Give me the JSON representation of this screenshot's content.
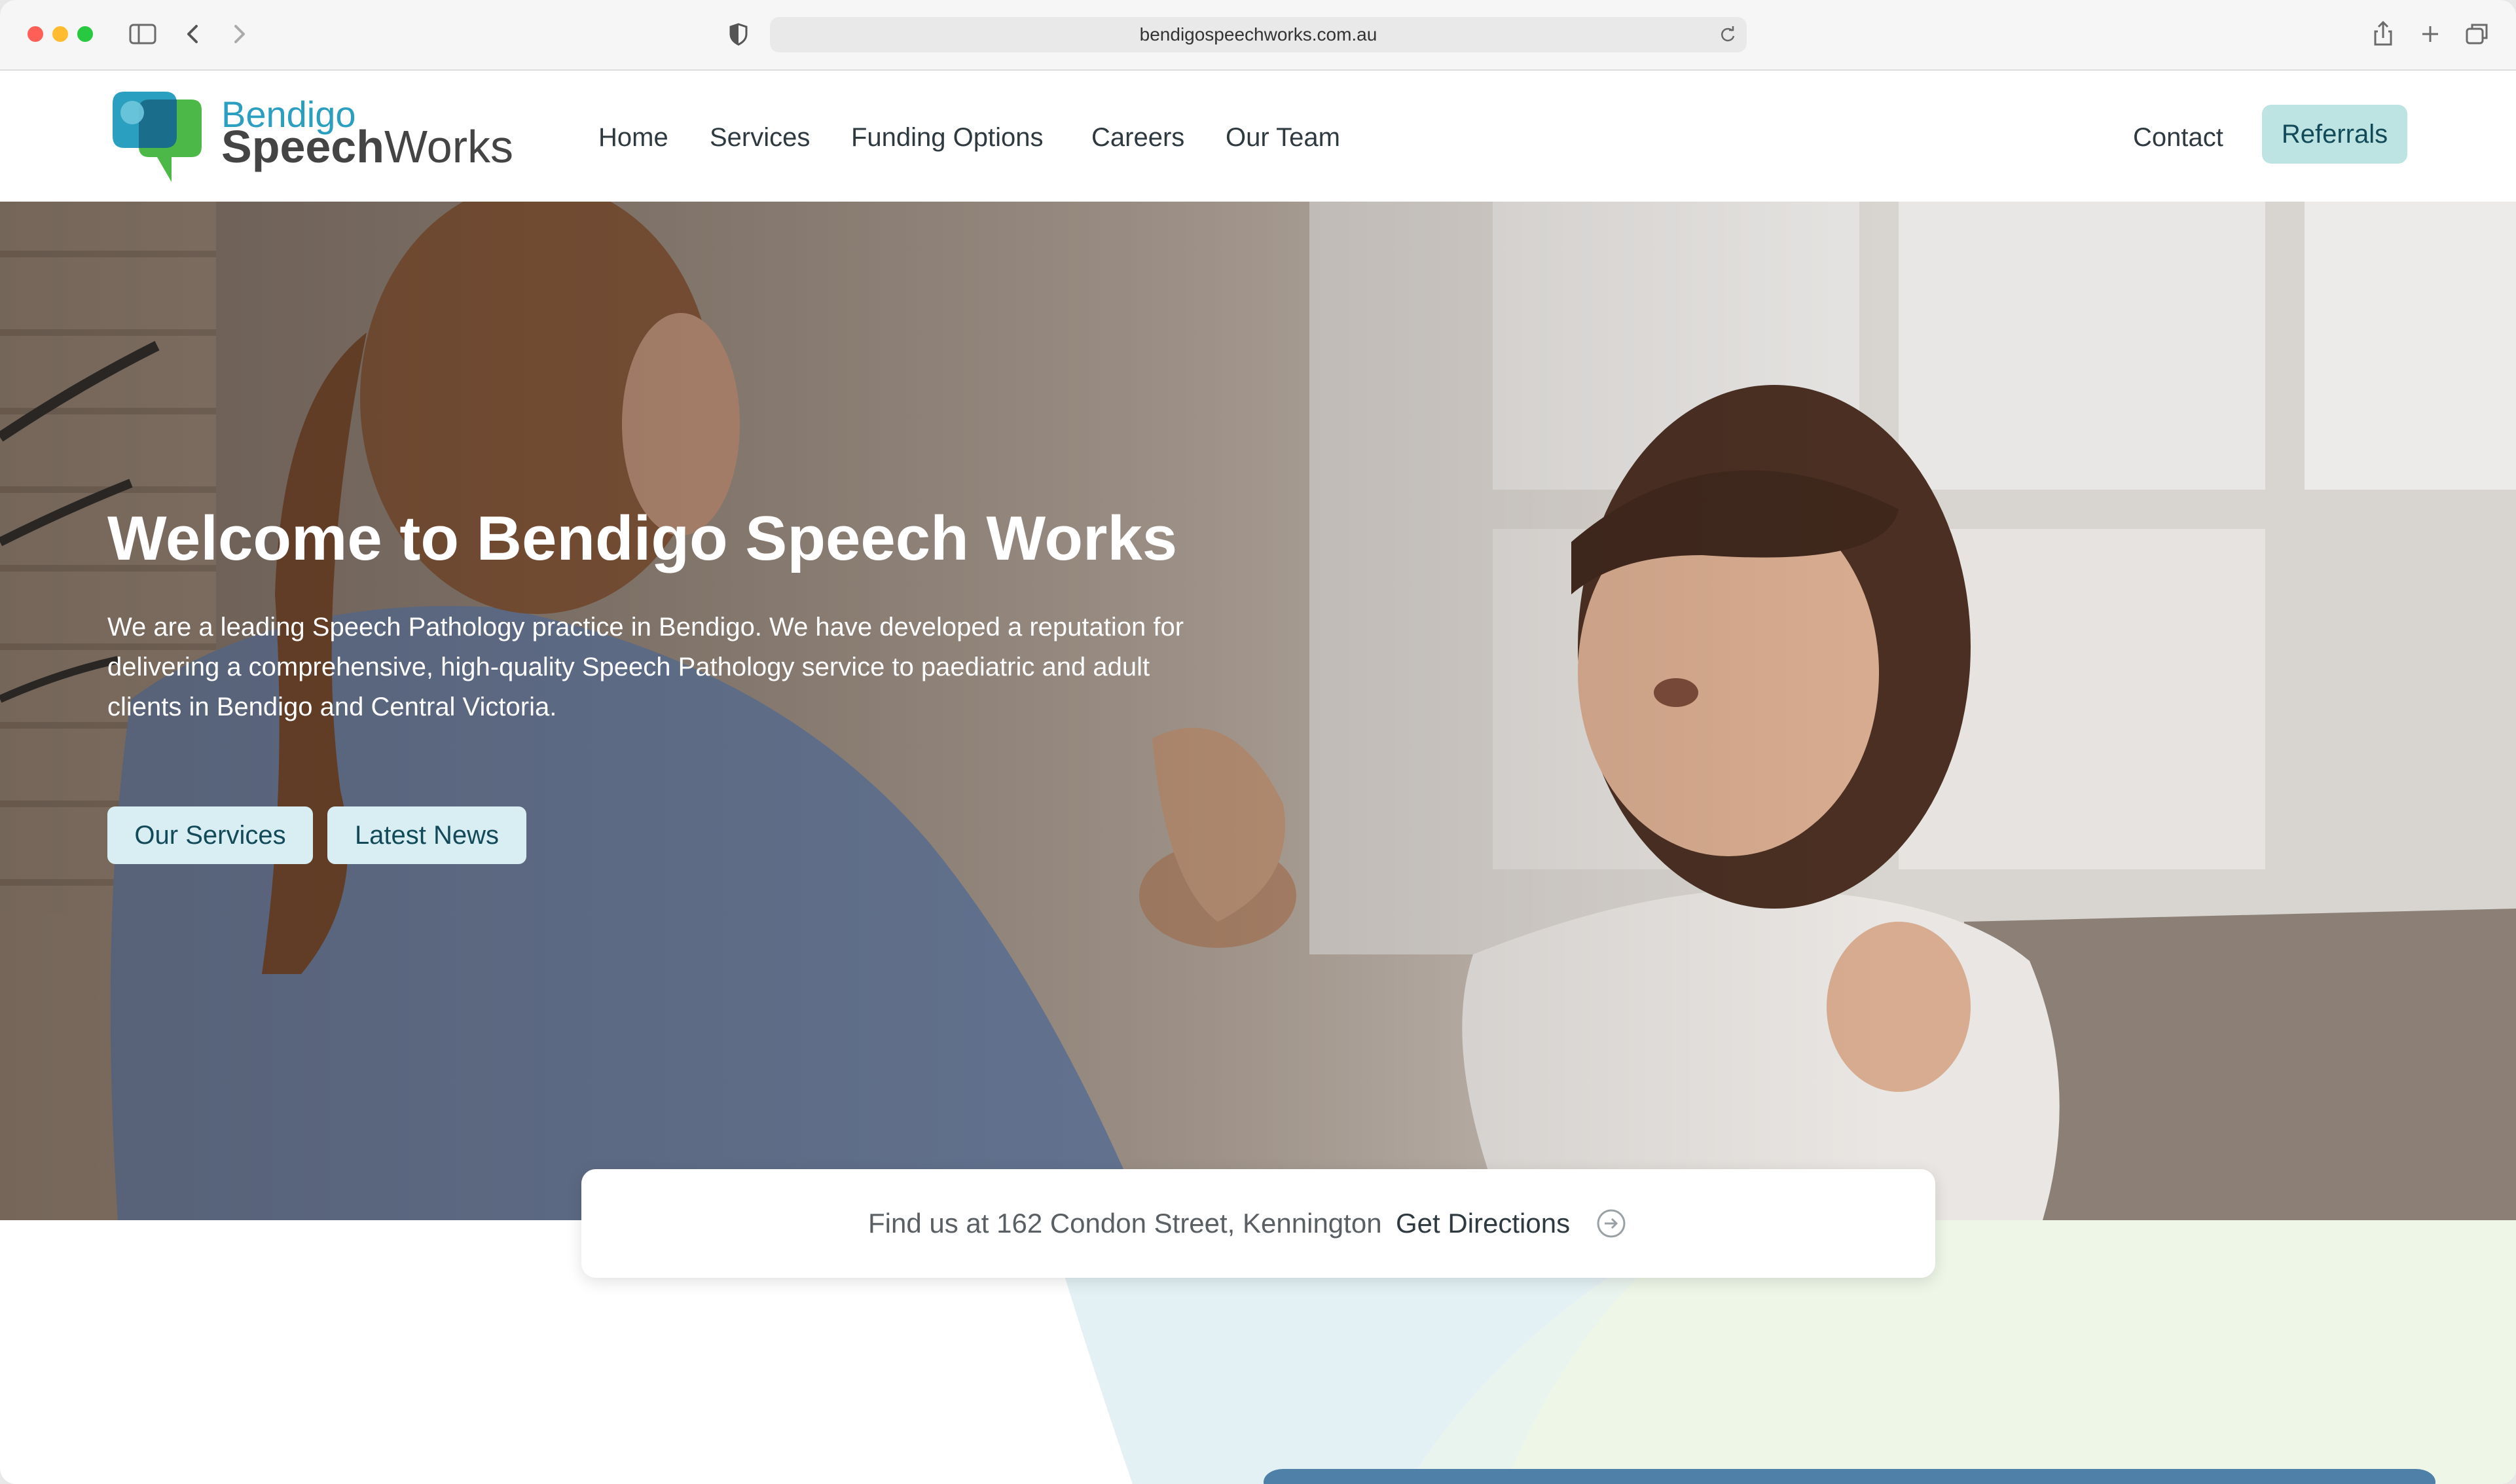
{
  "browser": {
    "url": "bendigospeechworks.com.au",
    "icons": [
      "sidebar-icon",
      "back-icon",
      "forward-icon",
      "shield-icon",
      "reload-icon",
      "share-icon",
      "new-tab-icon",
      "tabs-icon"
    ]
  },
  "logo": {
    "line1": "Bendigo",
    "line2_bold": "Speech",
    "line2_regular": "Works"
  },
  "nav": {
    "items": [
      "Home",
      "Services",
      "Funding Options",
      "Careers",
      "Our Team"
    ],
    "contact": "Contact",
    "referrals": "Referrals"
  },
  "hero": {
    "title": "Welcome to Bendigo Speech Works",
    "text": "We are a leading Speech Pathology practice in Bendigo. We have developed a reputation for delivering a comprehensive, high-quality Speech Pathology service to paediatric and adult clients in Bendigo and Central Victoria.",
    "buttons": {
      "services": "Our Services",
      "news": "Latest News"
    }
  },
  "directions": {
    "text": "Find us at 162 Condon Street, Kennington",
    "link": "Get Directions"
  },
  "colors": {
    "brand_teal": "#2b9fc0",
    "button_bg": "#bde4e2",
    "button_text": "#134a5a",
    "nav_text": "#2f3a40"
  }
}
